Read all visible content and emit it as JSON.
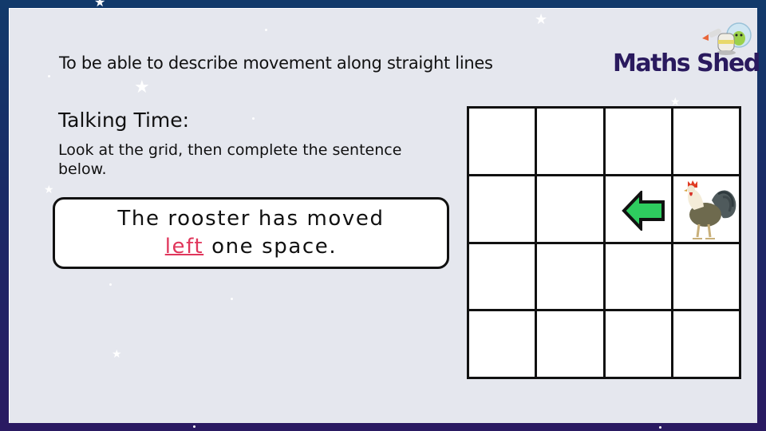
{
  "slide": {
    "objective": "To be able to describe movement along straight lines",
    "brand": {
      "name": "Maths Shed",
      "mascot_icon": "rocket-mascot-icon",
      "color": "#2a1a5e"
    },
    "section_title": "Talking Time:",
    "instruction": "Look at the grid, then complete the sentence below.",
    "sentence": {
      "line1": "The rooster has moved",
      "answer": "left",
      "line2_rest": " one space.",
      "answer_color": "#e0365b"
    },
    "grid": {
      "rows": 4,
      "cols": 4,
      "rooster": {
        "row": 2,
        "col": 4,
        "icon": "rooster-icon"
      },
      "arrow": {
        "row": 2,
        "col": 3,
        "direction": "left",
        "icon": "arrow-left-icon",
        "color": "#2ecc5f"
      }
    }
  }
}
